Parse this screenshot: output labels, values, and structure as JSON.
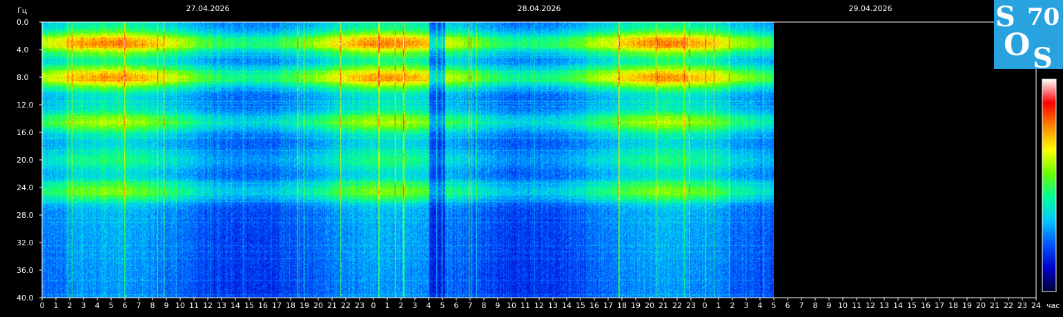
{
  "chart_data": {
    "type": "heatmap",
    "y_unit_label": "Гц",
    "x_unit_label": "час",
    "ylim": [
      0,
      40
    ],
    "y_ticks": [
      "0.0",
      "4.0",
      "8.0",
      "12.0",
      "16.0",
      "20.0",
      "24.0",
      "28.0",
      "32.0",
      "36.0",
      "40.0"
    ],
    "x_ticks": [
      "0",
      "1",
      "2",
      "3",
      "4",
      "5",
      "6",
      "7",
      "8",
      "9",
      "10",
      "11",
      "12",
      "13",
      "14",
      "15",
      "16",
      "17",
      "18",
      "19",
      "20",
      "21",
      "22",
      "23",
      "0",
      "1",
      "2",
      "3",
      "4",
      "5",
      "6",
      "7",
      "8",
      "9",
      "10",
      "11",
      "12",
      "13",
      "14",
      "15",
      "16",
      "17",
      "18",
      "19",
      "20",
      "21",
      "22",
      "23",
      "0",
      "1",
      "2",
      "3",
      "4",
      "5",
      "6",
      "7",
      "8",
      "9",
      "10",
      "11",
      "12",
      "13",
      "14",
      "15",
      "16",
      "17",
      "18",
      "19",
      "20",
      "21",
      "22",
      "23",
      "24"
    ],
    "dates": [
      "27.04.2026",
      "28.04.2026",
      "29.04.2026"
    ],
    "x_range_hours": [
      0,
      72
    ],
    "data_end_hours": 53,
    "bands": [
      {
        "freq": 3.0,
        "strength": "high"
      },
      {
        "freq": 8.0,
        "strength": "high"
      },
      {
        "freq": 14.5,
        "strength": "medium"
      },
      {
        "freq": 20.0,
        "strength": "low"
      },
      {
        "freq": 24.5,
        "strength": "medium"
      }
    ],
    "colorbar": [
      "#000033",
      "#0000cc",
      "#0055ff",
      "#00c8ff",
      "#00ff99",
      "#66ff00",
      "#ffff00",
      "#ff8800",
      "#ff0000",
      "#ffffff"
    ]
  },
  "logo": {
    "letters": [
      "S",
      "O",
      "S"
    ],
    "number": "70",
    "bg_color": "#29a3e0"
  }
}
